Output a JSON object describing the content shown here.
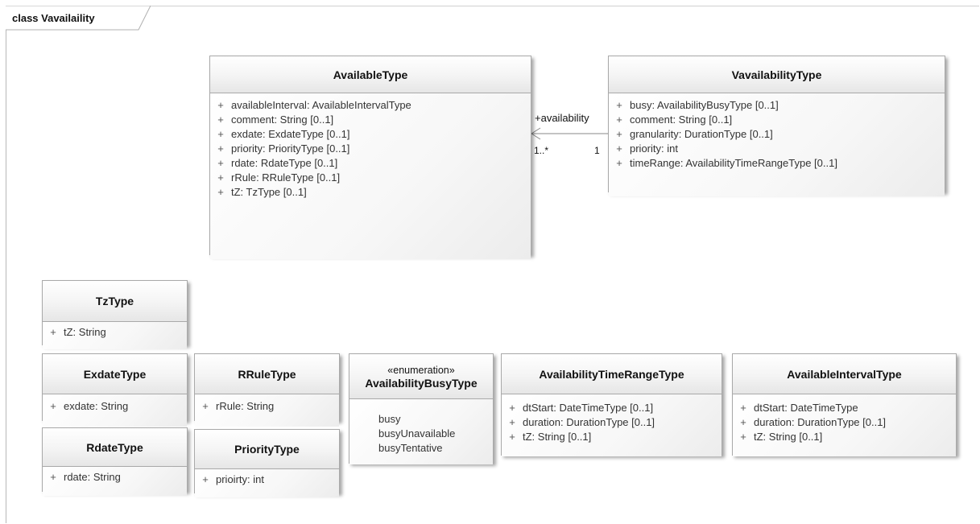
{
  "diagram": {
    "title": "class Vavailaility"
  },
  "classes": {
    "available": {
      "name": "AvailableType",
      "attributes": [
        {
          "vis": "+",
          "text": "availableInterval: AvailableIntervalType"
        },
        {
          "vis": "+",
          "text": "comment: String [0..1]"
        },
        {
          "vis": "+",
          "text": "exdate: ExdateType [0..1]"
        },
        {
          "vis": "+",
          "text": "priority: PriorityType [0..1]"
        },
        {
          "vis": "+",
          "text": "rdate: RdateType [0..1]"
        },
        {
          "vis": "+",
          "text": "rRule: RRuleType [0..1]"
        },
        {
          "vis": "+",
          "text": "tZ: TzType [0..1]"
        }
      ]
    },
    "vavailability": {
      "name": "VavailabilityType",
      "attributes": [
        {
          "vis": "+",
          "text": "busy: AvailabilityBusyType [0..1]"
        },
        {
          "vis": "+",
          "text": "comment: String [0..1]"
        },
        {
          "vis": "+",
          "text": "granularity: DurationType [0..1]"
        },
        {
          "vis": "+",
          "text": "priority: int"
        },
        {
          "vis": "+",
          "text": "timeRange: AvailabilityTimeRangeType [0..1]"
        }
      ]
    },
    "tz": {
      "name": "TzType",
      "attributes": [
        {
          "vis": "+",
          "text": "tZ: String"
        }
      ]
    },
    "exdate": {
      "name": "ExdateType",
      "attributes": [
        {
          "vis": "+",
          "text": "exdate: String"
        }
      ]
    },
    "rdate": {
      "name": "RdateType",
      "attributes": [
        {
          "vis": "+",
          "text": "rdate: String"
        }
      ]
    },
    "rrule": {
      "name": "RRuleType",
      "attributes": [
        {
          "vis": "+",
          "text": "rRule: String"
        }
      ]
    },
    "priority": {
      "name": "PriorityType",
      "attributes": [
        {
          "vis": "+",
          "text": "prioirty: int"
        }
      ]
    },
    "busy": {
      "stereotype": "«enumeration»",
      "name": "AvailabilityBusyType",
      "literals": [
        "busy",
        "busyUnavailable",
        "busyTentative"
      ]
    },
    "timerange": {
      "name": "AvailabilityTimeRangeType",
      "attributes": [
        {
          "vis": "+",
          "text": "dtStart: DateTimeType [0..1]"
        },
        {
          "vis": "+",
          "text": "duration: DurationType [0..1]"
        },
        {
          "vis": "+",
          "text": "tZ: String [0..1]"
        }
      ]
    },
    "interval": {
      "name": "AvailableIntervalType",
      "attributes": [
        {
          "vis": "+",
          "text": "dtStart: DateTimeType"
        },
        {
          "vis": "+",
          "text": "duration: DurationType [0..1]"
        },
        {
          "vis": "+",
          "text": "tZ: String [0..1]"
        }
      ]
    }
  },
  "association": {
    "role": "+availability",
    "source_multiplicity": "1..*",
    "target_multiplicity": "1"
  }
}
